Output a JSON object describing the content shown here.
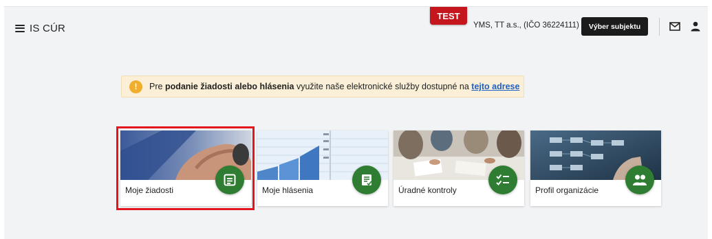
{
  "header": {
    "app_title": "IS CÚR",
    "env_badge": "TEST",
    "subject_info": "YMS, TT a.s., (IČO 36224111)",
    "select_subject_label": "Výber subjektu"
  },
  "notice": {
    "icon": "!",
    "text_before": "Pre ",
    "text_bold": "podanie žiadosti alebo hlásenia",
    "text_after": " využite naše elektronické služby dostupné na ",
    "link_text": "tejto adrese"
  },
  "tiles": [
    {
      "label": "Moje žiadosti",
      "icon": "request-document-icon"
    },
    {
      "label": "Moje hlásenia",
      "icon": "report-list-icon"
    },
    {
      "label": "Úradné kontroly",
      "icon": "checklist-icon"
    },
    {
      "label": "Profil organizácie",
      "icon": "people-icon"
    }
  ],
  "colors": {
    "badge_red": "#c4161c",
    "tile_icon_green": "#2e7d32",
    "highlight_red": "#e3141c",
    "notice_bg": "#fbf0d7",
    "link_blue": "#1f5fc7"
  }
}
